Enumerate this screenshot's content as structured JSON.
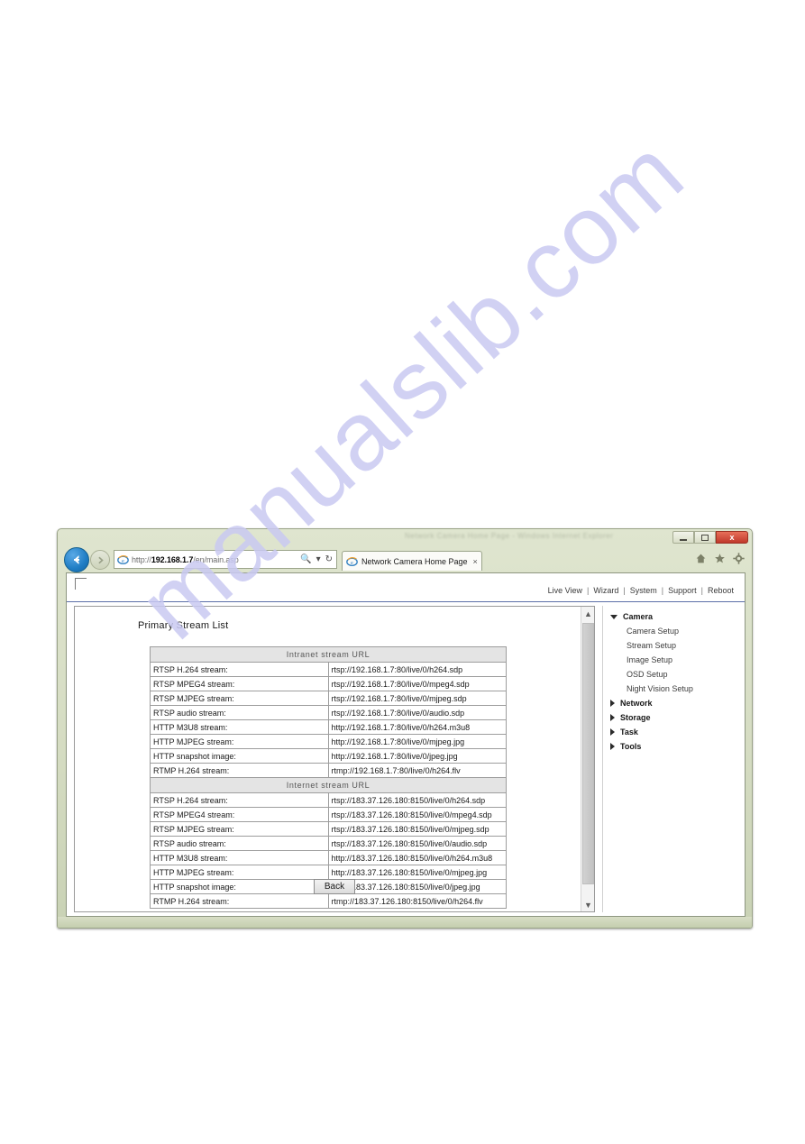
{
  "watermark": {
    "text": "manualslib.com"
  },
  "browser": {
    "faint_title_text": "Network Camera Home Page - Windows Internet Explorer",
    "window_controls": {
      "minimize_label": "Minimize",
      "maximize_label": "Maximize",
      "close_label": "x"
    },
    "navigation": {
      "back_label": "Back",
      "forward_label": "Forward",
      "address_scheme": "http://",
      "address_host": "192.168.1.7",
      "address_path": "/en/main.asp",
      "search_icon": "search-icon",
      "refresh_icon": "refresh-icon"
    },
    "tab": {
      "title": "Network Camera Home Page",
      "close_label": "×",
      "favicon": "internet-explorer-icon"
    },
    "toolbar": {
      "home_label": "Home",
      "favorites_label": "Favorites",
      "tools_label": "Tools"
    }
  },
  "page": {
    "top_nav": {
      "items": [
        {
          "label": "Live View"
        },
        {
          "label": "Wizard"
        },
        {
          "label": "System"
        },
        {
          "label": "Support"
        },
        {
          "label": "Reboot"
        }
      ],
      "separator": "|"
    },
    "title": "Primary Stream List",
    "back_button_label": "Back",
    "table": {
      "sections": [
        {
          "header": "Intranet stream URL",
          "rows": [
            {
              "label": "RTSP H.264 stream:",
              "value": "rtsp://192.168.1.7:80/live/0/h264.sdp"
            },
            {
              "label": "RTSP MPEG4 stream:",
              "value": "rtsp://192.168.1.7:80/live/0/mpeg4.sdp"
            },
            {
              "label": "RTSP MJPEG stream:",
              "value": "rtsp://192.168.1.7:80/live/0/mjpeg.sdp"
            },
            {
              "label": "RTSP audio stream:",
              "value": "rtsp://192.168.1.7:80/live/0/audio.sdp"
            },
            {
              "label": "HTTP M3U8 stream:",
              "value": "http://192.168.1.7:80/live/0/h264.m3u8"
            },
            {
              "label": "HTTP MJPEG stream:",
              "value": "http://192.168.1.7:80/live/0/mjpeg.jpg"
            },
            {
              "label": "HTTP snapshot image:",
              "value": "http://192.168.1.7:80/live/0/jpeg.jpg"
            },
            {
              "label": "RTMP H.264 stream:",
              "value": "rtmp://192.168.1.7:80/live/0/h264.flv"
            }
          ]
        },
        {
          "header": "Internet stream URL",
          "rows": [
            {
              "label": "RTSP H.264 stream:",
              "value": "rtsp://183.37.126.180:8150/live/0/h264.sdp"
            },
            {
              "label": "RTSP MPEG4 stream:",
              "value": "rtsp://183.37.126.180:8150/live/0/mpeg4.sdp"
            },
            {
              "label": "RTSP MJPEG stream:",
              "value": "rtsp://183.37.126.180:8150/live/0/mjpeg.sdp"
            },
            {
              "label": "RTSP audio stream:",
              "value": "rtsp://183.37.126.180:8150/live/0/audio.sdp"
            },
            {
              "label": "HTTP M3U8 stream:",
              "value": "http://183.37.126.180:8150/live/0/h264.m3u8"
            },
            {
              "label": "HTTP MJPEG stream:",
              "value": "http://183.37.126.180:8150/live/0/mjpeg.jpg"
            },
            {
              "label": "HTTP snapshot image:",
              "value": "http://183.37.126.180:8150/live/0/jpeg.jpg"
            },
            {
              "label": "RTMP H.264 stream:",
              "value": "rtmp://183.37.126.180:8150/live/0/h264.flv"
            }
          ]
        }
      ]
    },
    "side_menu": [
      {
        "label": "Camera",
        "expanded": true,
        "children": [
          {
            "label": "Camera Setup"
          },
          {
            "label": "Stream Setup"
          },
          {
            "label": "Image Setup"
          },
          {
            "label": "OSD Setup"
          },
          {
            "label": "Night Vision Setup"
          }
        ]
      },
      {
        "label": "Network",
        "expanded": false,
        "children": []
      },
      {
        "label": "Storage",
        "expanded": false,
        "children": []
      },
      {
        "label": "Task",
        "expanded": false,
        "children": []
      },
      {
        "label": "Tools",
        "expanded": false,
        "children": []
      }
    ]
  },
  "colors": {
    "chrome_green": "#d5dcc2",
    "close_red": "#c0392b",
    "back_blue": "#1f7dc4",
    "header_rule": "#5c6fa8",
    "watermark": "#c9c9f2"
  }
}
